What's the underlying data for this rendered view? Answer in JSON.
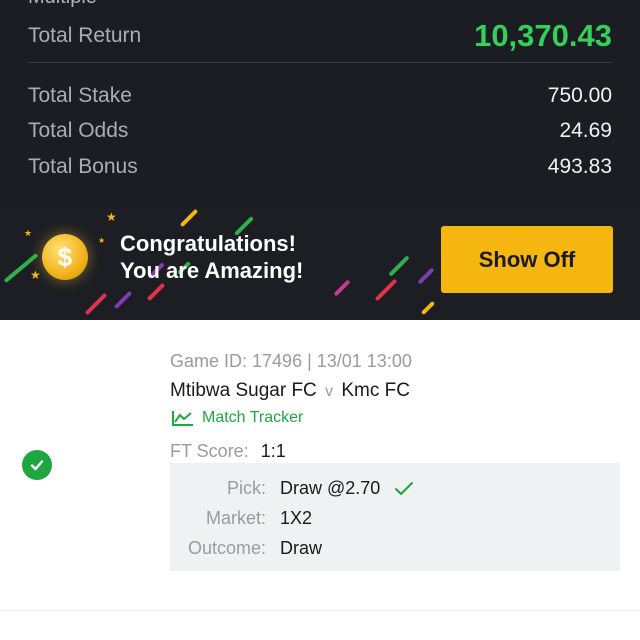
{
  "summary": {
    "partial_label": "Multiple",
    "total_return_label": "Total Return",
    "total_return_value": "10,370.43",
    "total_stake_label": "Total Stake",
    "total_stake_value": "750.00",
    "total_odds_label": "Total Odds",
    "total_odds_value": "24.69",
    "total_bonus_label": "Total Bonus",
    "total_bonus_value": "493.83"
  },
  "banner": {
    "line1": "Congratulations!",
    "line2": "You are Amazing!",
    "coin_symbol": "$",
    "show_off_label": "Show Off"
  },
  "bet": {
    "game_id": "Game ID: 17496 | 13/01 13:00",
    "home_team": "Mtibwa Sugar FC",
    "vs": "v",
    "away_team": "Kmc FC",
    "match_tracker_label": "Match Tracker",
    "ft_score_label": "FT Score:",
    "ft_score_value": "1:1",
    "pick_label": "Pick:",
    "pick_value": "Draw @2.70",
    "market_label": "Market:",
    "market_value": "1X2",
    "outcome_label": "Outcome:",
    "outcome_value": "Draw"
  },
  "colors": {
    "dark_bg": "#1c1d22",
    "win_green": "#35d05a",
    "accent_yellow": "#f5b70f",
    "success_green": "#1ea63f"
  },
  "icons": [
    "gold-coin-icon",
    "check-circle-icon",
    "chart-line-icon",
    "checkmark-icon"
  ]
}
